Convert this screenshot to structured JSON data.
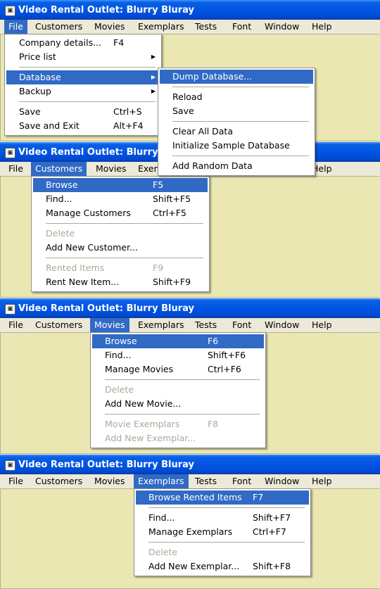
{
  "app_title": "Video Rental Outlet: Blurry Bluray",
  "app_icon": "app-window-icon",
  "menubar": {
    "file": "File",
    "customers": "Customers",
    "movies": "Movies",
    "exemplars": "Exemplars",
    "tests": "Tests",
    "font": "Font",
    "window": "Window",
    "help": "Help"
  },
  "file_menu": {
    "company_details": "Company details...",
    "company_details_sc": "F4",
    "price_list": "Price list",
    "database": "Database",
    "backup": "Backup",
    "save": "Save",
    "save_sc": "Ctrl+S",
    "save_exit": "Save and Exit",
    "save_exit_sc": "Alt+F4"
  },
  "database_submenu": {
    "dump": "Dump Database...",
    "reload": "Reload",
    "save": "Save",
    "clear": "Clear All Data",
    "init_sample": "Initialize Sample Database",
    "add_random": "Add Random Data"
  },
  "customers_menu": {
    "browse": "Browse",
    "browse_sc": "F5",
    "find": "Find...",
    "find_sc": "Shift+F5",
    "manage": "Manage Customers",
    "manage_sc": "Ctrl+F5",
    "delete": "Delete",
    "add_new": "Add New Customer...",
    "rented_items": "Rented Items",
    "rented_items_sc": "F9",
    "rent_new": "Rent New Item...",
    "rent_new_sc": "Shift+F9"
  },
  "movies_menu": {
    "browse": "Browse",
    "browse_sc": "F6",
    "find": "Find...",
    "find_sc": "Shift+F6",
    "manage": "Manage Movies",
    "manage_sc": "Ctrl+F6",
    "delete": "Delete",
    "add_new": "Add New Movie...",
    "movie_exemplars": "Movie Exemplars",
    "movie_exemplars_sc": "F8",
    "add_new_exemplar": "Add New Exemplar..."
  },
  "exemplars_menu": {
    "browse_rented": "Browse Rented Items",
    "browse_rented_sc": "F7",
    "find": "Find...",
    "find_sc": "Shift+F7",
    "manage": "Manage Exemplars",
    "manage_sc": "Ctrl+F7",
    "delete": "Delete",
    "add_new": "Add New Exemplar...",
    "add_new_sc": "Shift+F8"
  }
}
